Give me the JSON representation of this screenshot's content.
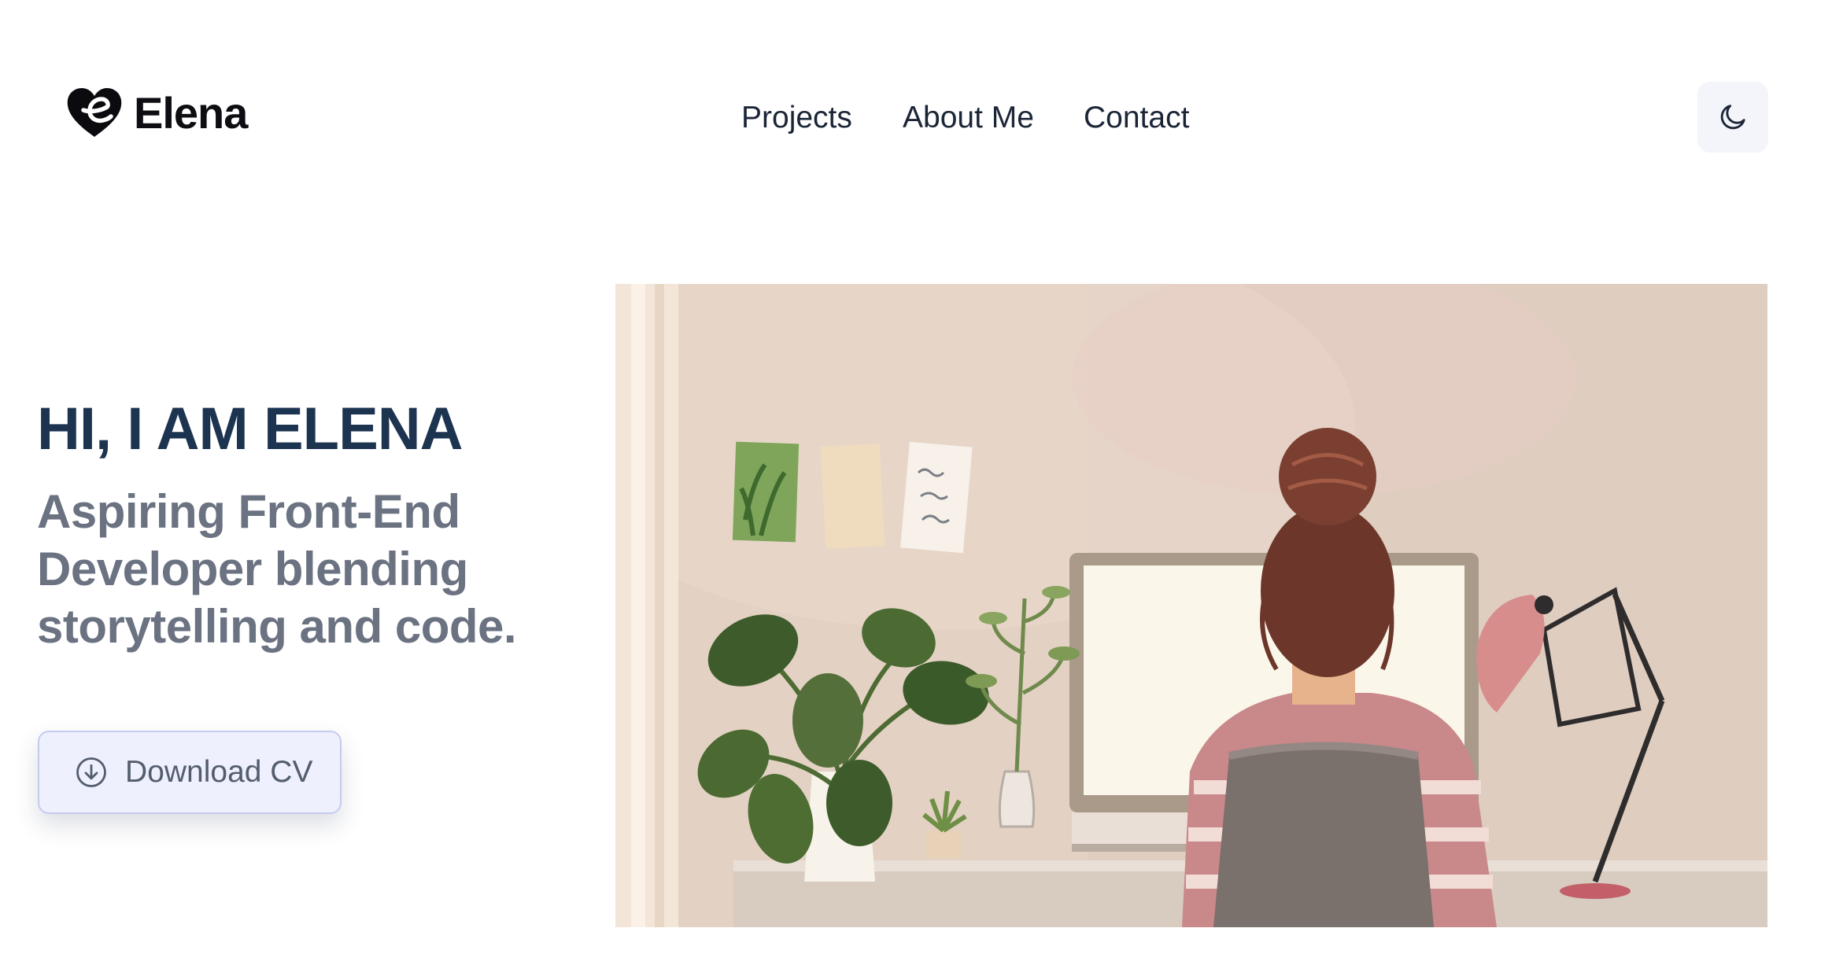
{
  "header": {
    "logo": {
      "icon": "heart-e-logo-icon",
      "text": "Elena"
    },
    "nav": [
      {
        "label": "Projects"
      },
      {
        "label": "About Me"
      },
      {
        "label": "Contact"
      }
    ],
    "theme_toggle": {
      "icon": "moon-icon"
    }
  },
  "hero": {
    "title": "HI, I AM ELENA",
    "subtitle": "Aspiring Front-End Developer blending storytelling and code.",
    "cta": {
      "label": "Download CV",
      "icon": "download-circle-icon"
    },
    "illustration": {
      "icon": "woman-at-desk-illustration"
    }
  },
  "colors": {
    "heading": "#1d3451",
    "subtitle": "#6b7281",
    "nav_text": "#1b2536",
    "button_bg": "#eef0fd",
    "button_border": "#c6cbee",
    "toggle_bg": "#f4f5fa"
  }
}
